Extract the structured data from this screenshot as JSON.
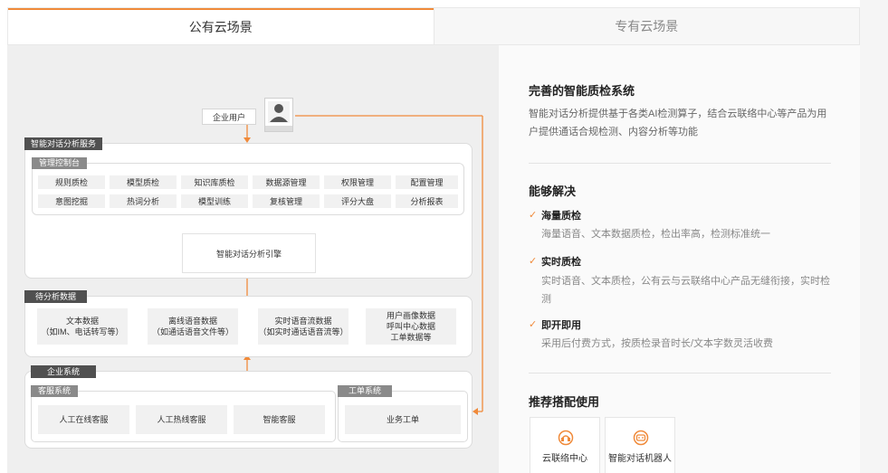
{
  "tabs": [
    {
      "label": "公有云场景"
    },
    {
      "label": "专有云场景"
    }
  ],
  "diagram": {
    "user_label": "企业用户",
    "service_title": "智能对话分析服务",
    "console_title": "管理控制台",
    "console_row1": [
      "规则质检",
      "模型质检",
      "知识库质检",
      "数据源管理",
      "权限管理",
      "配置管理"
    ],
    "console_row2": [
      "意图挖掘",
      "热词分析",
      "模型训练",
      "复核管理",
      "评分大盘",
      "分析报表"
    ],
    "engine_label": "智能对话分析引擎",
    "data_title": "待分析数据",
    "data_items": [
      {
        "line1": "文本数据",
        "line2": "（如IM、电话转写等）"
      },
      {
        "line1": "离线语音数据",
        "line2": "（如通话语音文件等）"
      },
      {
        "line1": "实时语音流数据",
        "line2": "（如实时通话语音流等）"
      },
      {
        "line1": "用户画像数据",
        "line2": "呼叫中心数据",
        "line3": "工单数据等"
      }
    ],
    "enterprise_title": "企业系统",
    "cs_title": "客服系统",
    "cs_items": [
      "人工在线客服",
      "人工热线客服",
      "智能客服"
    ],
    "ticket_title": "工单系统",
    "ticket_item": "业务工单"
  },
  "right": {
    "title": "完善的智能质检系统",
    "description": "智能对话分析提供基于各类AI检测算子，结合云联络中心等产品为用户提供通话合规检测、内容分析等功能",
    "solve_title": "能够解决",
    "features": [
      {
        "title": "海量质检",
        "desc": "海量语音、文本数据质检，检出率高，检测标准统一"
      },
      {
        "title": "实时质检",
        "desc": "实时语音、文本质检，公有云与云联络中心产品无缝衔接，实时检测"
      },
      {
        "title": "即开即用",
        "desc": "采用后付费方式，按质检录音时长/文本字数灵活收费"
      }
    ],
    "recommend_title": "推荐搭配使用",
    "recommend": [
      {
        "label": "云联络中心",
        "icon": "cloud-contact-center-icon"
      },
      {
        "label": "智能对话机器人",
        "icon": "chatbot-icon"
      }
    ]
  },
  "colors": {
    "accent": "#f08a3a",
    "dark_label": "#505050",
    "grey_label": "#8a8a8a"
  }
}
